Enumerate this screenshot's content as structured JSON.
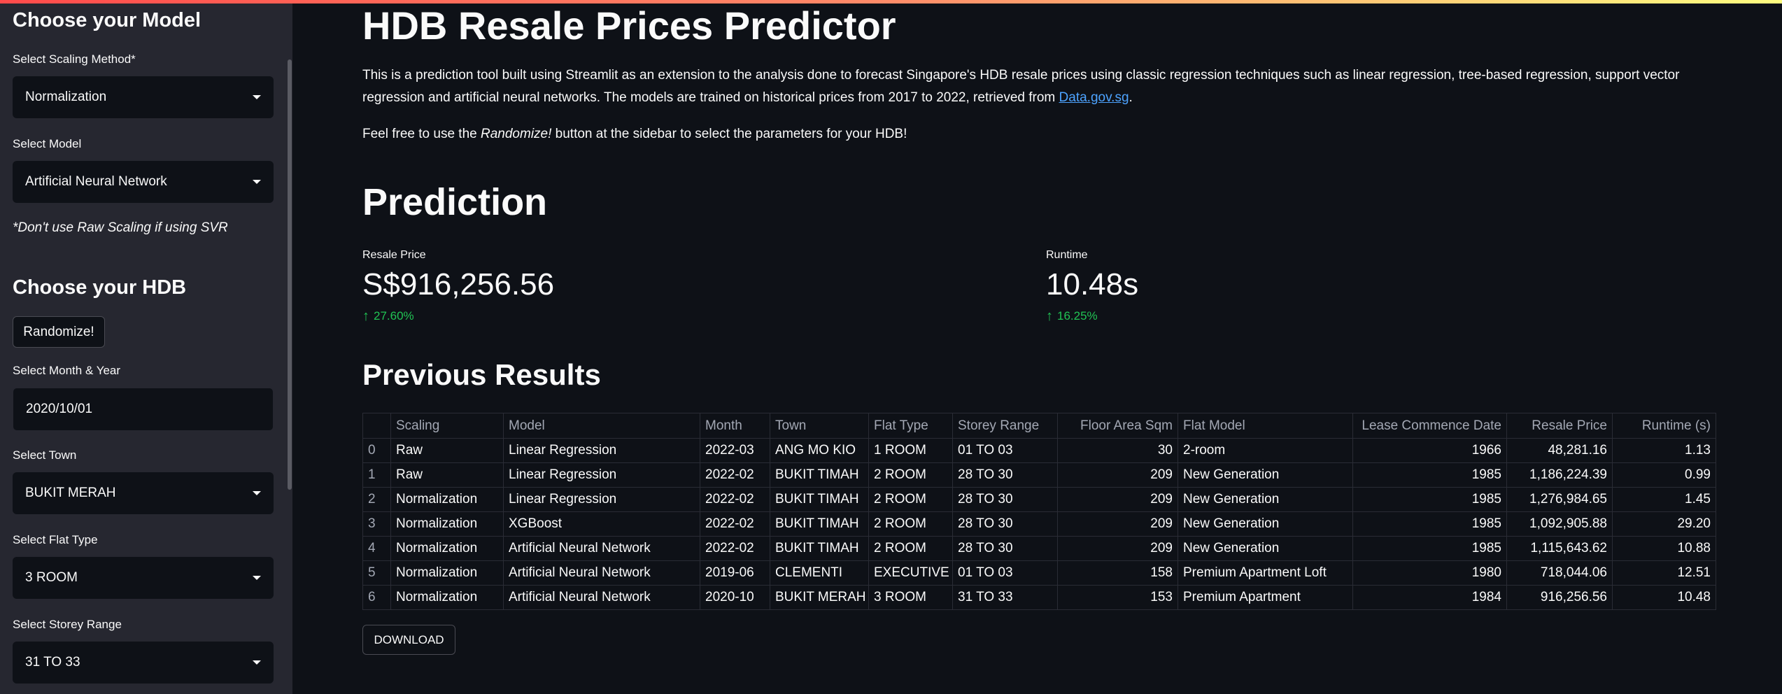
{
  "sidebar": {
    "model_heading": "Choose your Model",
    "scaling_label": "Select Scaling Method*",
    "scaling_value": "Normalization",
    "model_label": "Select Model",
    "model_value": "Artificial Neural Network",
    "note": "*Don't use Raw Scaling if using SVR",
    "hdb_heading": "Choose your HDB",
    "randomize_label": "Randomize!",
    "month_label": "Select Month & Year",
    "month_value": "2020/10/01",
    "town_label": "Select Town",
    "town_value": "BUKIT MERAH",
    "flat_type_label": "Select Flat Type",
    "flat_type_value": "3 ROOM",
    "storey_label": "Select Storey Range",
    "storey_value": "31 TO 33"
  },
  "main": {
    "title": "HDB Resale Prices Predictor",
    "intro_1": "This is a prediction tool built using Streamlit as an extension to the analysis done to forecast Singapore's HDB resale prices using classic regression techniques such as linear regression, tree-based regression, support vector regression and artificial neural networks. The models are trained on historical prices from 2017 to 2022, retrieved from",
    "intro_link": "Data.gov.sg",
    "intro_end": ".",
    "intro_2_pre": "Feel free to use the",
    "intro_2_em": "Randomize!",
    "intro_2_post": "button at the sidebar to select the parameters for your HDB!",
    "prediction_heading": "Prediction",
    "metrics": [
      {
        "label": "Resale Price",
        "value": "S$916,256.56",
        "delta": "27.60%"
      },
      {
        "label": "Runtime",
        "value": "10.48s",
        "delta": "16.25%"
      }
    ],
    "previous_heading": "Previous Results",
    "download_label": "DOWNLOAD",
    "colors": {
      "accent_green": "#21c354",
      "link": "#4da3ff",
      "bg": "#0e1117",
      "sidebar_bg": "#262730"
    }
  },
  "table": {
    "columns": [
      "",
      "Scaling",
      "Model",
      "Month",
      "Town",
      "Flat Type",
      "Storey Range",
      "Floor Area Sqm",
      "Flat Model",
      "Lease Commence Date",
      "Resale Price",
      "Runtime (s)"
    ],
    "rows": [
      [
        "0",
        "Raw",
        "Linear Regression",
        "2022-03",
        "ANG MO KIO",
        "1 ROOM",
        "01 TO 03",
        "30",
        "2-room",
        "1966",
        "48,281.16",
        "1.13"
      ],
      [
        "1",
        "Raw",
        "Linear Regression",
        "2022-02",
        "BUKIT TIMAH",
        "2 ROOM",
        "28 TO 30",
        "209",
        "New Generation",
        "1985",
        "1,186,224.39",
        "0.99"
      ],
      [
        "2",
        "Normalization",
        "Linear Regression",
        "2022-02",
        "BUKIT TIMAH",
        "2 ROOM",
        "28 TO 30",
        "209",
        "New Generation",
        "1985",
        "1,276,984.65",
        "1.45"
      ],
      [
        "3",
        "Normalization",
        "XGBoost",
        "2022-02",
        "BUKIT TIMAH",
        "2 ROOM",
        "28 TO 30",
        "209",
        "New Generation",
        "1985",
        "1,092,905.88",
        "29.20"
      ],
      [
        "4",
        "Normalization",
        "Artificial Neural Network",
        "2022-02",
        "BUKIT TIMAH",
        "2 ROOM",
        "28 TO 30",
        "209",
        "New Generation",
        "1985",
        "1,115,643.62",
        "10.88"
      ],
      [
        "5",
        "Normalization",
        "Artificial Neural Network",
        "2019-06",
        "CLEMENTI",
        "EXECUTIVE",
        "01 TO 03",
        "158",
        "Premium Apartment Loft",
        "1980",
        "718,044.06",
        "12.51"
      ],
      [
        "6",
        "Normalization",
        "Artificial Neural Network",
        "2020-10",
        "BUKIT MERAH",
        "3 ROOM",
        "31 TO 33",
        "153",
        "Premium Apartment",
        "1984",
        "916,256.56",
        "10.48"
      ]
    ]
  }
}
